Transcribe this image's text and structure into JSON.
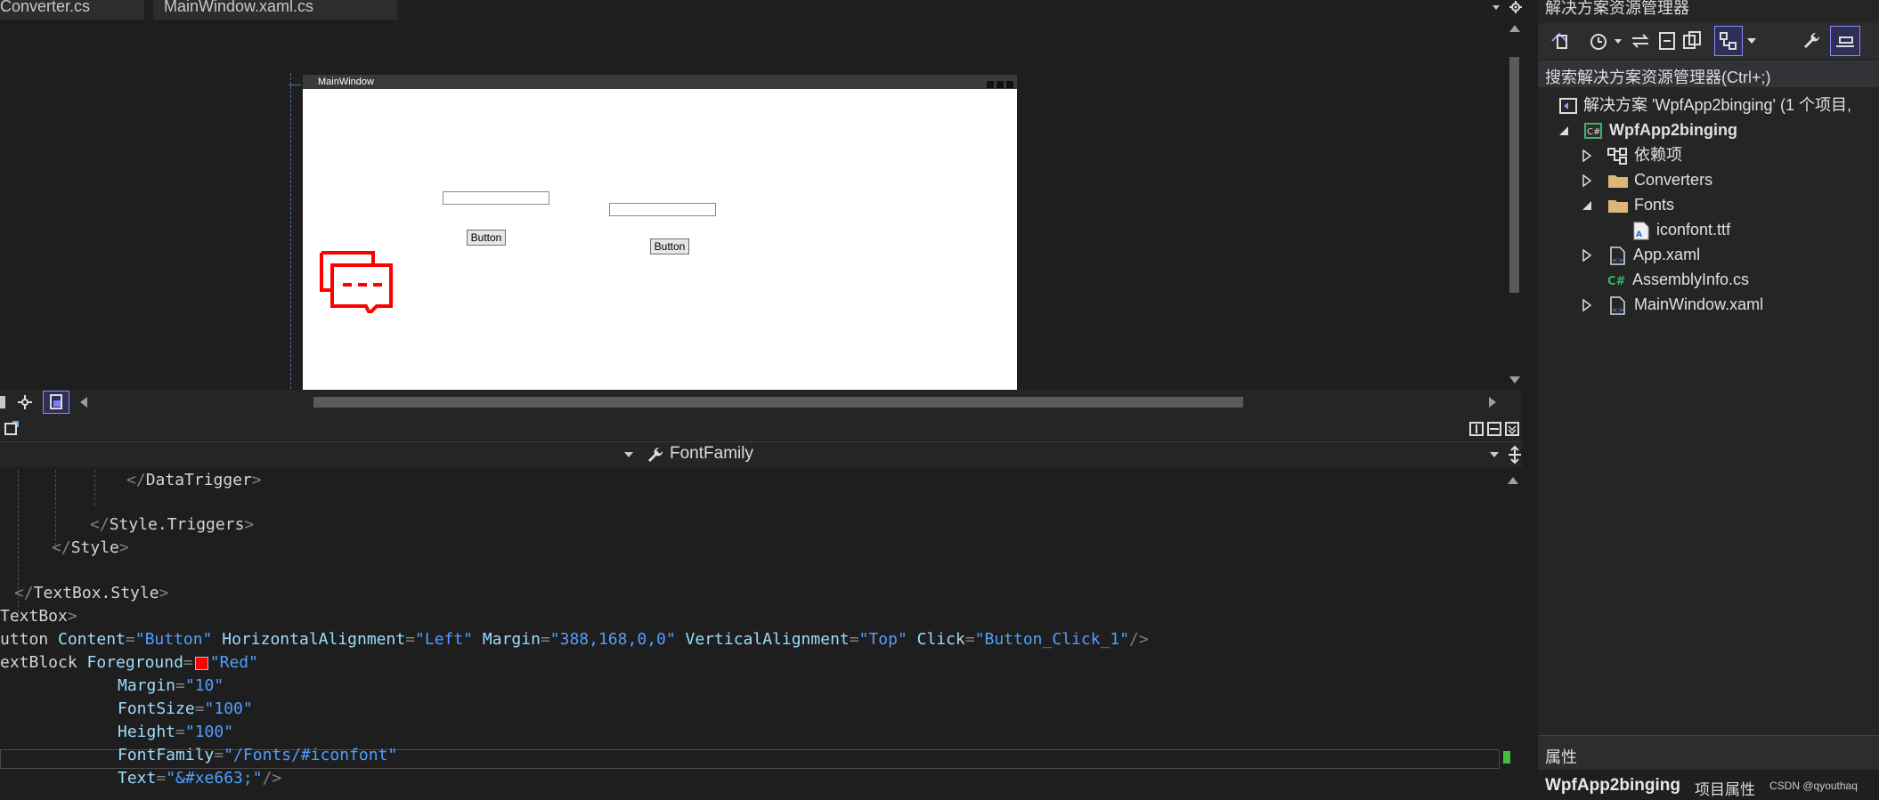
{
  "tabs": [
    {
      "label": "Converter.cs"
    },
    {
      "label": "MainWindow.xaml.cs"
    }
  ],
  "designer": {
    "window_title": "MainWindow",
    "buttons": [
      "Button",
      "Button"
    ],
    "icon_color": "#ff0000"
  },
  "code_toolbar": {
    "property_label": "FontFamily"
  },
  "code_lines": [
    {
      "text": "</DataTrigger>"
    },
    {
      "text": "</Style.Triggers>"
    },
    {
      "text": "</Style>"
    },
    {
      "text": "</TextBox.Style>"
    },
    {
      "text": "TextBox>"
    },
    {
      "text": "utton Content=\"Button\" HorizontalAlignment=\"Left\" Margin=\"388,168,0,0\" VerticalAlignment=\"Top\" Click=\"Button_Click_1\"/>"
    },
    {
      "text": "extBlock Foreground=\"Red\""
    },
    {
      "text": "Margin=\"10\""
    },
    {
      "text": "FontSize=\"100\""
    },
    {
      "text": "Height=\"100\""
    },
    {
      "text": "FontFamily=\"/Fonts/#iconfont\""
    },
    {
      "text": "Text=\"&#xe663;\"/>"
    }
  ],
  "solution_explorer": {
    "title": "解决方案资源管理器",
    "search_placeholder": "搜索解决方案资源管理器(Ctrl+;)",
    "solution_label": "解决方案 'WpfApp2binging' (1 个项目,",
    "project": "WpfApp2binging",
    "items": [
      {
        "label": "依赖项"
      },
      {
        "label": "Converters"
      },
      {
        "label": "Fonts"
      },
      {
        "label": "iconfont.ttf"
      },
      {
        "label": "App.xaml"
      },
      {
        "label": "AssemblyInfo.cs"
      },
      {
        "label": "MainWindow.xaml"
      }
    ]
  },
  "properties": {
    "title": "属性",
    "object": "WpfApp2binging",
    "type_label": "项目属性",
    "watermark": "CSDN @qyouthaq"
  },
  "colors": {
    "accent": "#007acc",
    "csharp_green": "#68217a",
    "folder": "#dcb67a"
  }
}
